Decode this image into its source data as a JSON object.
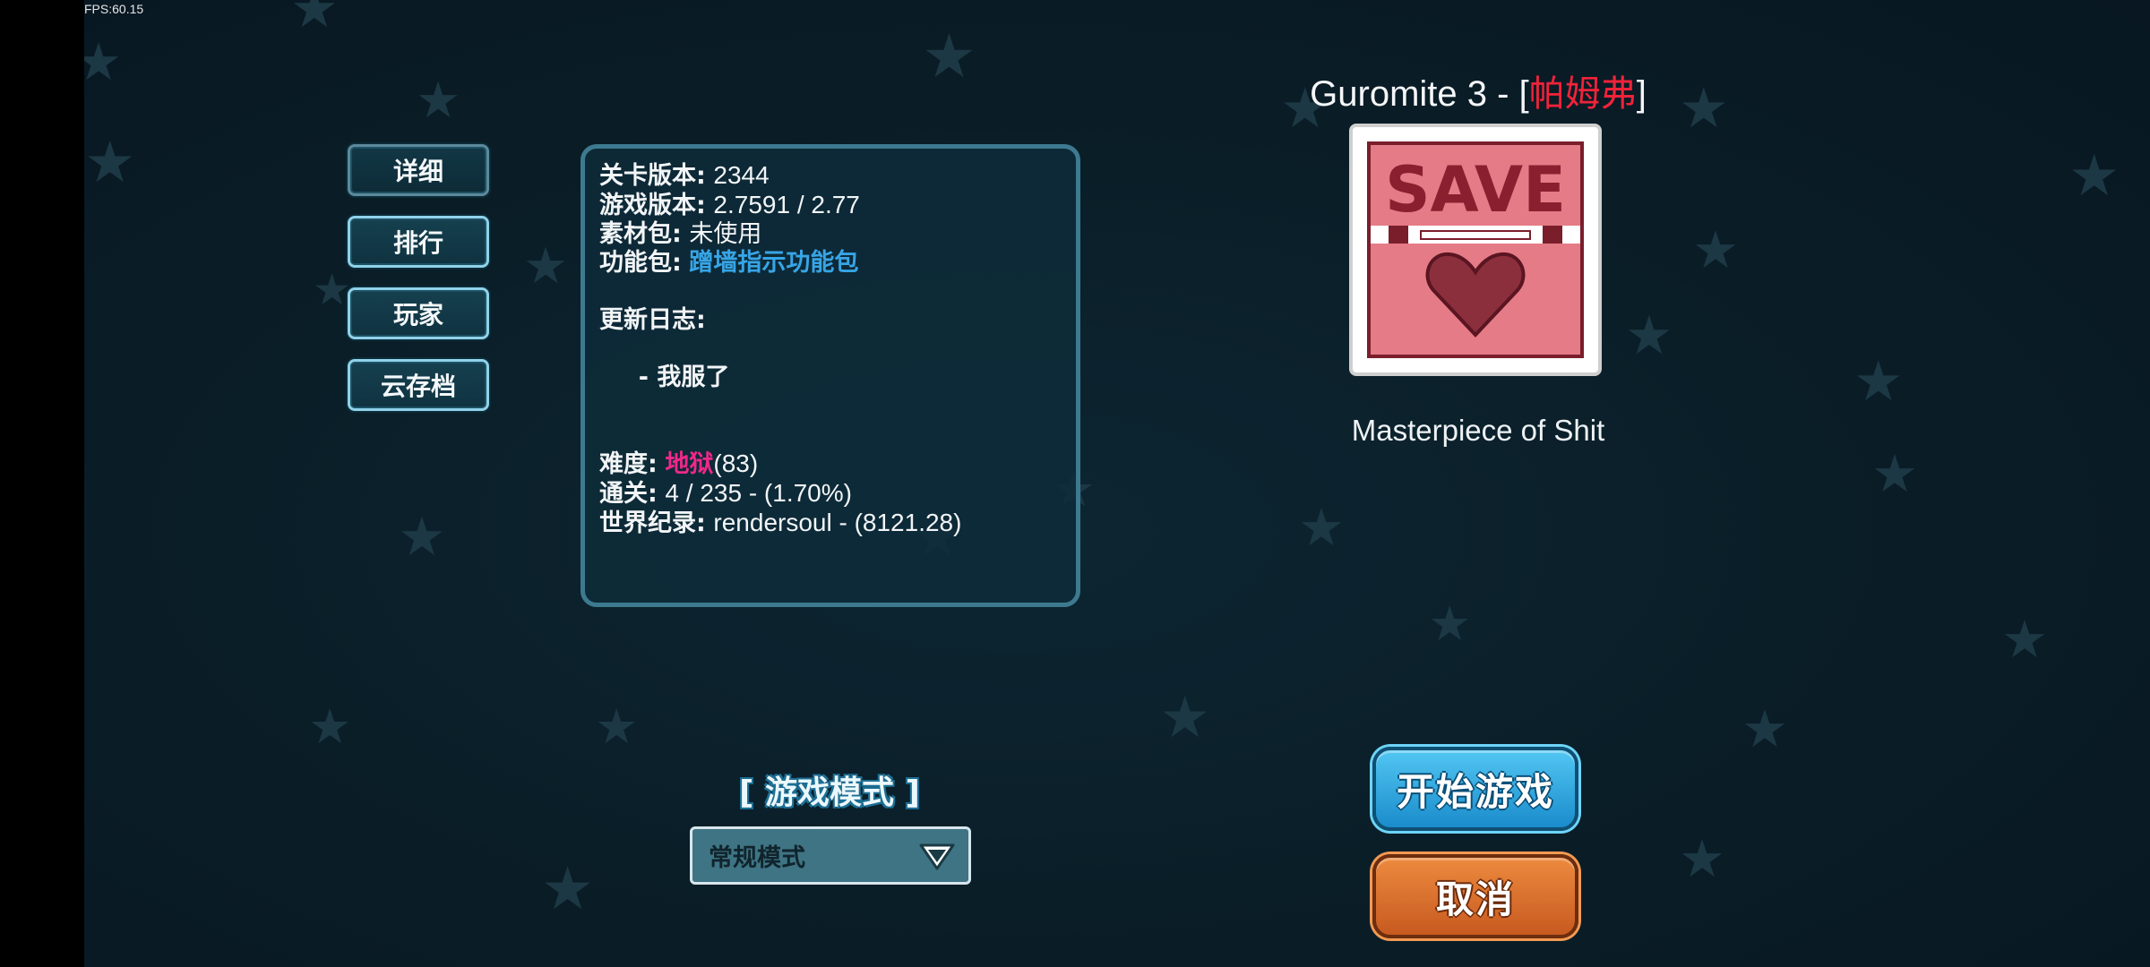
{
  "fps": "FPS:60.15",
  "side_menu": {
    "details": "详细",
    "ranking": "排行",
    "players": "玩家",
    "cloud_save": "云存档"
  },
  "info": {
    "level_version_label": "关卡版本:",
    "level_version": "2344",
    "game_version_label": "游戏版本:",
    "game_version": "2.7591 / 2.77",
    "asset_pack_label": "素材包:",
    "asset_pack": "未使用",
    "feature_pack_label": "功能包:",
    "feature_pack": "蹭墙指示功能包",
    "changelog_label": "更新日志:",
    "changelog_entry": " - 我服了",
    "difficulty_label": "难度:",
    "difficulty_name": "地狱",
    "difficulty_value": "(83)",
    "clears_label": "通关:",
    "clears": "4 / 235 - (1.70%)",
    "world_record_label": "世界纪录:",
    "world_record": "rendersoul - (8121.28)"
  },
  "level": {
    "title_prefix": "Guromite 3 - [",
    "title_tag": "帕姆弗",
    "title_suffix": "]",
    "author": "Masterpiece of Shit",
    "thumbnail_text": "SAVE"
  },
  "mode": {
    "title": "[ 游戏模式 ]",
    "selected": "常规模式"
  },
  "buttons": {
    "start": "开始游戏",
    "cancel": "取消"
  },
  "colors": {
    "accent_blue": "#37a5e6",
    "difficulty_pink": "#f0288a",
    "title_red": "#f0233a",
    "start_button": "#2aa6e0",
    "cancel_button": "#d96e2c"
  }
}
